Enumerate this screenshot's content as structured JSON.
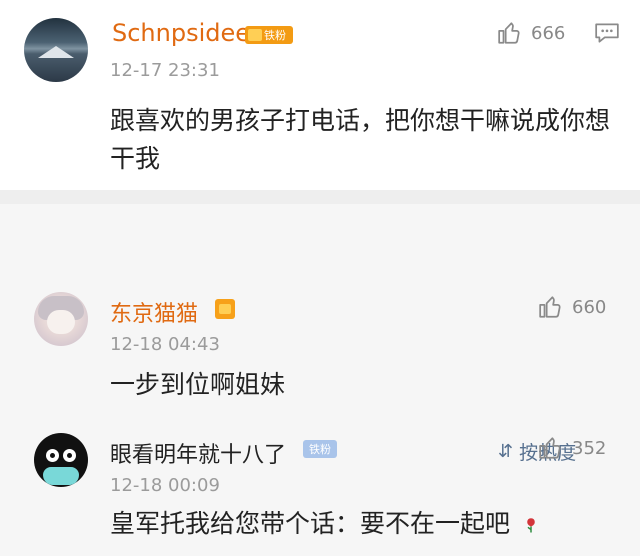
{
  "main_post": {
    "author": "Schnpsidee",
    "badge": "铁粉",
    "timestamp": "12-17 23:31",
    "like_count": "666",
    "content": "跟喜欢的男孩子打电话，把你想干嘛说成你想干我"
  },
  "sort": {
    "label": "按热度",
    "icon_name": "sort-icon"
  },
  "comments": [
    {
      "author": "东京猫猫",
      "timestamp": "12-18 04:43",
      "like_count": "660",
      "content": "一步到位啊姐妹"
    },
    {
      "author": "眼看明年就十八了",
      "badge": "铁粉",
      "timestamp": "12-18 00:09",
      "like_count": "352",
      "content": "皇军托我给您带个话：要不在一起吧"
    }
  ],
  "colors": {
    "author_orange": "#e06a12",
    "badge_orange": "#f39b13",
    "badge_blue": "#a9c4ea",
    "muted_text": "#9b9b9b",
    "sort_blue": "#56708f"
  },
  "icons": {
    "like": "thumb-up-icon",
    "comment": "comment-icon",
    "rose": "rose-icon"
  }
}
